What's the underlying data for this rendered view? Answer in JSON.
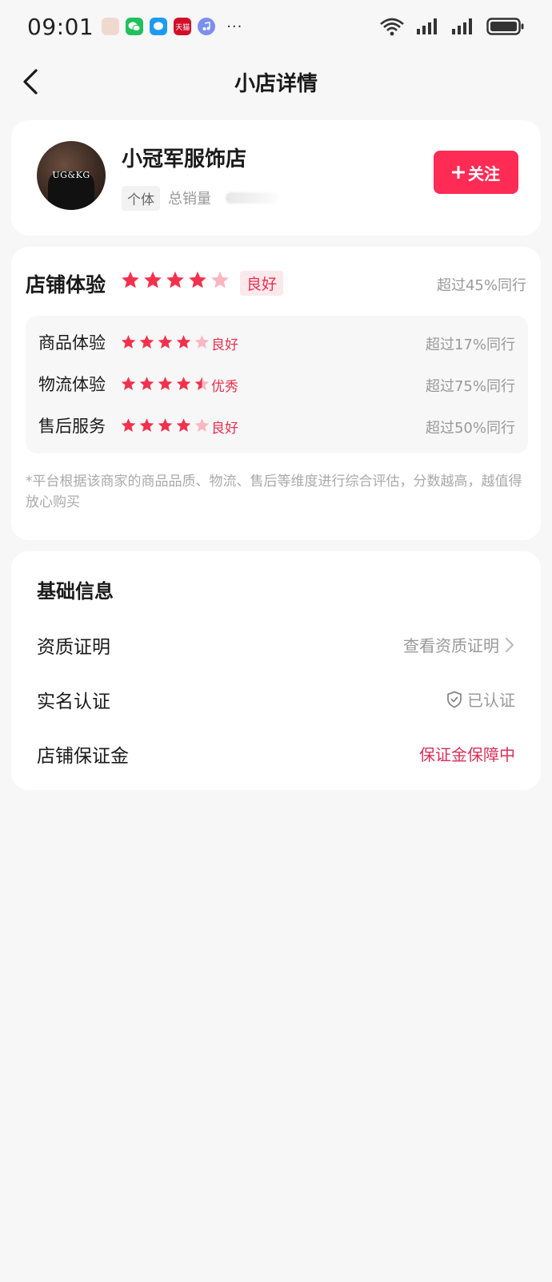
{
  "status_bar": {
    "time": "09:01",
    "notif_tianmao": "天猫",
    "more_indicator": "···"
  },
  "nav": {
    "title": "小店详情"
  },
  "shop": {
    "name": "小冠军服饰店",
    "avatar_text": "UG&KG",
    "type_tag": "个体",
    "total_sales_label": "总销量",
    "follow_label": "关注"
  },
  "experience": {
    "title": "店铺体验",
    "rating_stars": 4,
    "grade": "良好",
    "percent_text": "超过45%同行",
    "sub_items": [
      {
        "label": "商品体验",
        "stars": 4,
        "grade": "良好",
        "percent_text": "超过17%同行"
      },
      {
        "label": "物流体验",
        "stars": 4.5,
        "grade": "优秀",
        "percent_text": "超过75%同行"
      },
      {
        "label": "售后服务",
        "stars": 4,
        "grade": "良好",
        "percent_text": "超过50%同行"
      }
    ],
    "note": "*平台根据该商家的商品品质、物流、售后等维度进行综合评估，分数越高，越值得放心购买"
  },
  "basic_info": {
    "title": "基础信息",
    "rows": [
      {
        "label": "资质证明",
        "value": "查看资质证明"
      },
      {
        "label": "实名认证",
        "value": "已认证"
      },
      {
        "label": "店铺保证金",
        "value": "保证金保障中"
      }
    ]
  },
  "colors": {
    "accent": "#fe2c55",
    "star_filled": "#f2324d",
    "star_empty": "#f7b8c3",
    "background": "#f7f7f7"
  }
}
